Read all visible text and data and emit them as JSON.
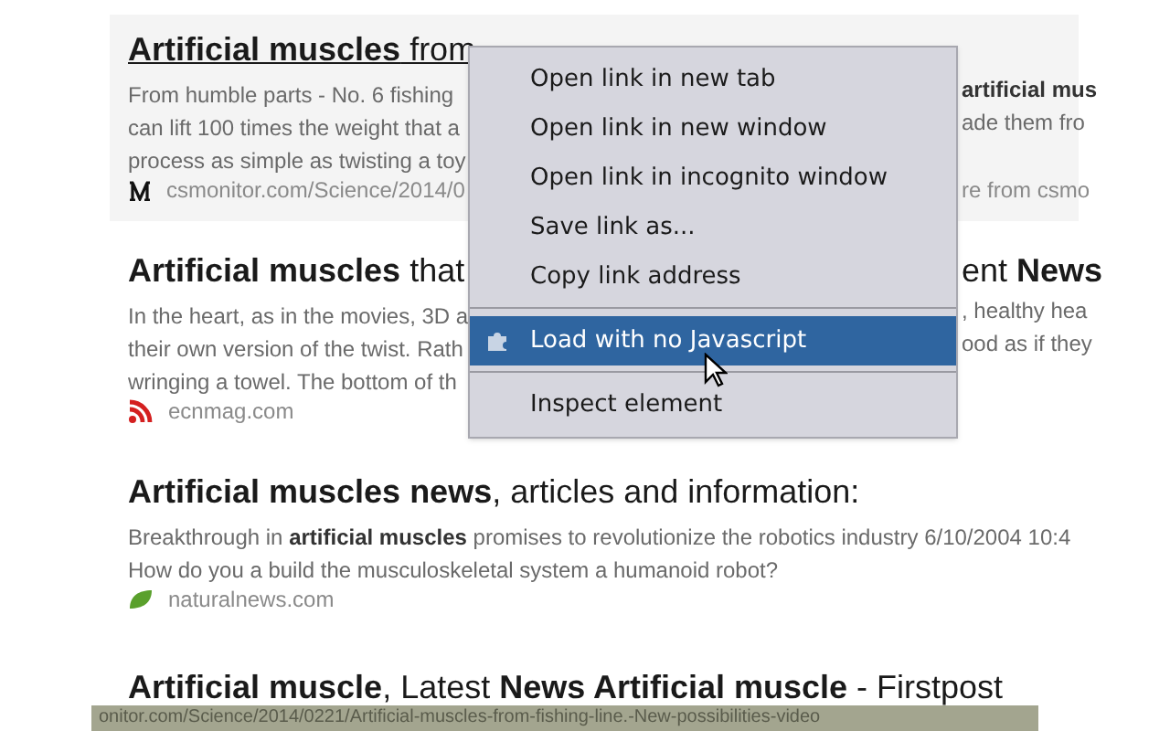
{
  "results": [
    {
      "hovered": true,
      "title": "**Artificial muscles** from",
      "lines": [
        {
          "left": "From humble parts - No. 6 fishing",
          "right": "**artificial mus**"
        },
        {
          "left": "can lift 100 times the weight that a",
          "right": "ade them fro"
        },
        {
          "left": "process as simple as twisting a toy"
        }
      ],
      "source": {
        "left": "csmonitor.com/Science/2014/0",
        "right": "re from csmo"
      }
    },
    {
      "hovered": false,
      "title": "**Artificial muscles** that",
      "title_right": "ent **News**",
      "lines": [
        {
          "left": "In the heart, as in the movies, 3D a",
          "right": ", healthy hea"
        },
        {
          "left": "their own version of the twist. Rath",
          "right": "ood as if they"
        },
        {
          "left": "wringing a towel. The bottom of th"
        }
      ],
      "source": {
        "left": "ecnmag.com"
      }
    },
    {
      "hovered": false,
      "title": "**Artificial muscles news**, articles and information:",
      "lines": [
        {
          "left": "Breakthrough in **artificial muscles** promises to revolutionize the robotics industry 6/10/2004 10:4"
        },
        {
          "left": "How do you a build the musculoskeletal system a humanoid robot?"
        }
      ],
      "source": {
        "left": "naturalnews.com"
      }
    },
    {
      "hovered": false,
      "title": "**Artificial muscle**, Latest **News Artificial muscle** - Firstpost"
    }
  ],
  "context_menu": {
    "items": [
      {
        "kind": "item",
        "label": "Open link in new tab",
        "selected": false
      },
      {
        "kind": "item",
        "label": "Open link in new window",
        "selected": false
      },
      {
        "kind": "item",
        "label": "Open link in incognito window",
        "selected": false
      },
      {
        "kind": "item",
        "label": "Save link as...",
        "selected": false
      },
      {
        "kind": "item",
        "label": "Copy link address",
        "selected": false
      },
      {
        "kind": "separator"
      },
      {
        "kind": "extension",
        "label": "Load with no Javascript",
        "selected": true
      },
      {
        "kind": "separator"
      },
      {
        "kind": "item",
        "label": "Inspect element",
        "selected": false
      }
    ]
  },
  "status_bar": {
    "text": "onitor.com/Science/2014/0221/Artificial-muscles-from-fishing-line.-New-possibilities-video"
  }
}
